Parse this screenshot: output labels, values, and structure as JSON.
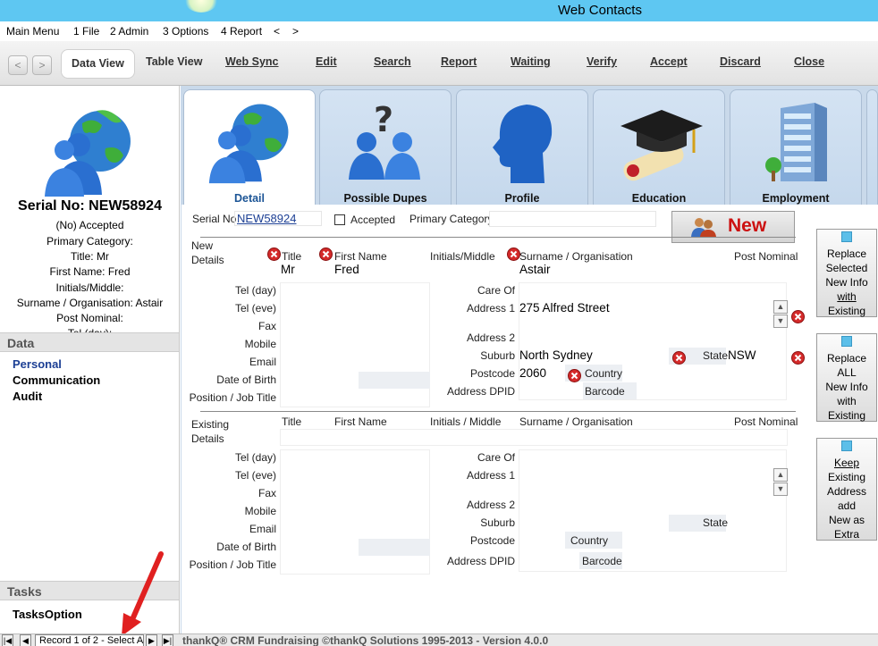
{
  "window": {
    "title": "Web Contacts"
  },
  "menu": {
    "items": [
      "Main Menu",
      "1 File",
      "2 Admin",
      "3 Options",
      "4 Report",
      "<",
      ">"
    ]
  },
  "toolbar": {
    "prev": "<",
    "next": ">",
    "buttons": [
      "Data View",
      "Table View",
      "Web Sync",
      "Edit",
      "Search",
      "Report",
      "Waiting",
      "Verify",
      "Accept",
      "Discard",
      "Close"
    ]
  },
  "sidebar": {
    "serial_heading": "Serial No: NEW58924",
    "info": [
      "(No) Accepted",
      "Primary Category:",
      "Title: Mr",
      "First Name: Fred",
      "Initials/Middle:",
      "Surname / Organisation: Astair",
      "Post Nominal:",
      "Tel (day):"
    ],
    "data_section": "Data",
    "data_links": [
      "Personal",
      "Communication",
      "Audit"
    ],
    "tasks_section": "Tasks",
    "tasks_links": [
      "TasksOption"
    ]
  },
  "tabs": [
    "Detail",
    "Possible Dupes",
    "Profile",
    "Education",
    "Employment"
  ],
  "form": {
    "serial_label": "Serial No",
    "serial_value": "NEW58924",
    "accepted_label": "Accepted",
    "primary_category_label": "Primary Category",
    "new_badge": "New",
    "new_details_label_1": "New",
    "new_details_label_2": "Details",
    "col_title": "Title",
    "col_first_name": "First Name",
    "col_initials": "Initials/Middle",
    "col_surname": "Surname / Organisation",
    "col_post_nominal": "Post Nominal",
    "new_title": "Mr",
    "new_first_name": "Fred",
    "new_surname": "Astair",
    "left_labels": [
      "Tel (day)",
      "Tel (eve)",
      "Fax",
      "Mobile",
      "Email",
      "Date of Birth",
      "Position / Job Title"
    ],
    "care_of": "Care Of",
    "address1": "Address 1",
    "address2": "Address 2",
    "suburb": "Suburb",
    "state": "State",
    "postcode": "Postcode",
    "country": "Country",
    "address_dpid": "Address DPID",
    "barcode": "Barcode",
    "new_address1": "275 Alfred Street",
    "new_suburb": "North Sydney",
    "new_state": "NSW",
    "new_postcode": "2060",
    "existing_details_label_1": "Existing",
    "existing_details_label_2": "Details",
    "col_initials_existing": "Initials / Middle"
  },
  "action_buttons": [
    {
      "lines": [
        "Replace",
        "Selected",
        "New Info",
        "with",
        "Existing"
      ]
    },
    {
      "lines": [
        "Replace",
        "ALL",
        "New Info",
        "with",
        "Existing"
      ]
    },
    {
      "lines": [
        "Keep",
        "Existing",
        "Address",
        "add",
        "New as",
        "Extra"
      ]
    }
  ],
  "statusbar": {
    "record": "Record 1 of 2",
    "select": "- Select A",
    "copyright": "thankQ® CRM Fundraising ©thankQ Solutions 1995-2013 - Version 4.0.0"
  },
  "colors": {
    "titlebar": "#5ec7f2",
    "main_bg": "#c9d9ea",
    "new_badge_text": "#cc1111",
    "link": "#1c3f94"
  }
}
